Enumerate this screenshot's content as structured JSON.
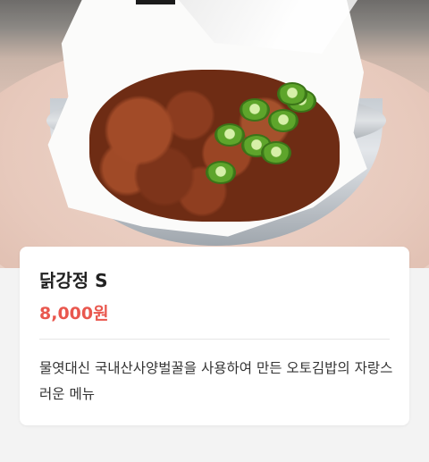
{
  "menu_item": {
    "name": "닭강정 S",
    "price": "8,000원",
    "description": "물엿대신 국내산사양벌꿀을 사용하여 만든 오토김밥의 자랑스러운 메뉴"
  },
  "colors": {
    "price": "#e9574e",
    "title": "#222222",
    "background": "#f3f3f3"
  }
}
